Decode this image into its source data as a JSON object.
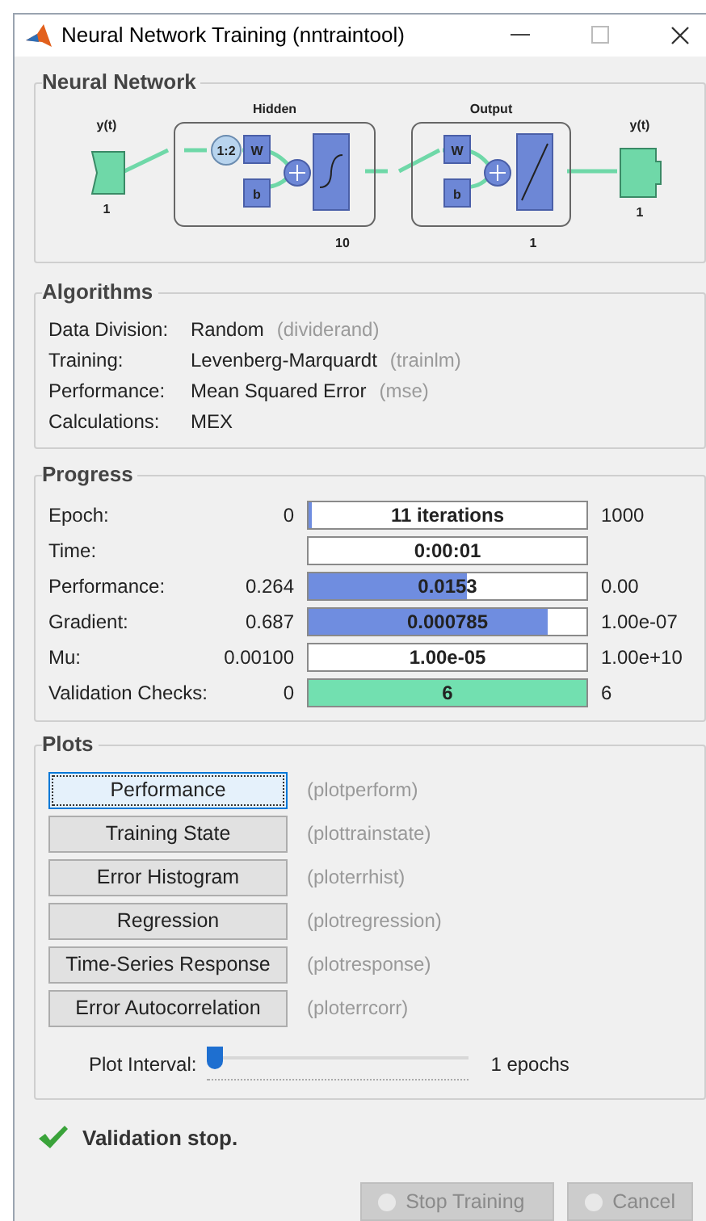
{
  "window": {
    "title": "Neural Network Training (nntraintool)"
  },
  "network": {
    "title": "Neural Network",
    "input": {
      "label": "y(t)",
      "size": "1"
    },
    "hidden": {
      "title": "Hidden",
      "delay": "1:2",
      "weight": "W",
      "bias": "b",
      "size": "10"
    },
    "output_layer": {
      "title": "Output",
      "weight": "W",
      "bias": "b",
      "size": "1"
    },
    "output": {
      "label": "y(t)",
      "size": "1"
    }
  },
  "algorithms": {
    "title": "Algorithms",
    "rows": [
      {
        "label": "Data Division:",
        "value": "Random",
        "function": "(dividerand)"
      },
      {
        "label": "Training:",
        "value": "Levenberg-Marquardt",
        "function": "(trainlm)"
      },
      {
        "label": "Performance:",
        "value": "Mean Squared Error",
        "function": "(mse)"
      },
      {
        "label": "Calculations:",
        "value": "MEX"
      }
    ]
  },
  "progress": {
    "title": "Progress",
    "rows": [
      {
        "label": "Epoch:",
        "min": "0",
        "value": "11 iterations",
        "level": 0.011,
        "color": "#6f8de0",
        "max": "1000"
      },
      {
        "label": "Time:",
        "value": "0:00:01",
        "level": 0
      },
      {
        "label": "Performance:",
        "min": "0.264",
        "value": "0.0153",
        "level": 0.57,
        "color": "#6f8de0",
        "max": "0.00"
      },
      {
        "label": "Gradient:",
        "min": "0.687",
        "value": "0.000785",
        "level": 0.86,
        "color": "#6f8de0",
        "max": "1.00e-07"
      },
      {
        "label": "Mu:",
        "min": "0.00100",
        "value": "1.00e-05",
        "level": 0,
        "max": "1.00e+10"
      },
      {
        "label": "Validation Checks:",
        "min": "0",
        "value": "6",
        "level": 1,
        "color": "#72e0b0",
        "max": "6"
      }
    ]
  },
  "plots": {
    "title": "Plots",
    "buttons": [
      {
        "label": "Performance",
        "function": "(plotperform)",
        "selected": true
      },
      {
        "label": "Training State",
        "function": "(plottrainstate)",
        "selected": false
      },
      {
        "label": "Error Histogram",
        "function": "(ploterrhist)",
        "selected": false
      },
      {
        "label": "Regression",
        "function": "(plotregression)",
        "selected": false
      },
      {
        "label": "Time-Series Response",
        "function": "(plotresponse)",
        "selected": false
      },
      {
        "label": "Error Autocorrelation",
        "function": "(ploterrcorr)",
        "selected": false
      }
    ],
    "interval": {
      "label": "Plot Interval:",
      "level": 0,
      "reading": "1 epochs"
    }
  },
  "status": "Validation stop.",
  "buttons": [
    {
      "label": "Stop Training",
      "disabled": true
    },
    {
      "label": "Cancel",
      "disabled": true
    }
  ]
}
